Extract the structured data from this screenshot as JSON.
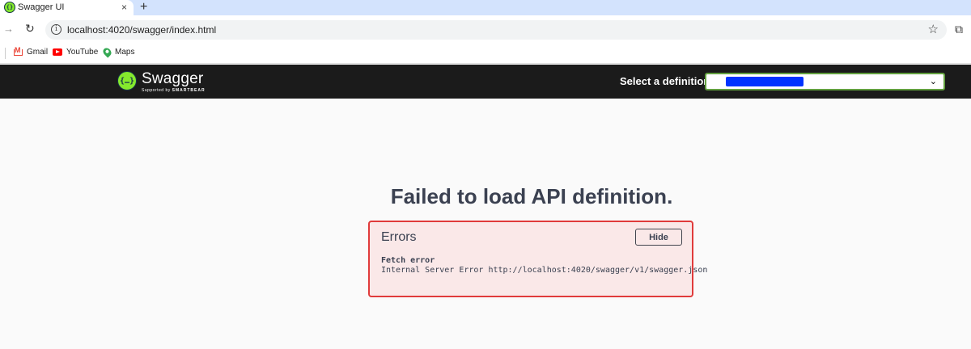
{
  "browser": {
    "tab_title": "Swagger UI",
    "tab_close": "×",
    "new_tab": "+",
    "url": "localhost:4020/swagger/index.html",
    "icons": {
      "favicon": "swagger-favicon",
      "forward": "forward-arrow-icon",
      "reload": "reload-icon",
      "info": "info-icon",
      "star": "star-icon",
      "extensions": "puzzle-icon"
    }
  },
  "bookmarks": [
    {
      "label": "Gmail",
      "icon": "gmail-icon"
    },
    {
      "label": "YouTube",
      "icon": "youtube-icon"
    },
    {
      "label": "Maps",
      "icon": "maps-icon"
    }
  ],
  "swagger": {
    "logo_text": "Swagger",
    "logo_sub_prefix": "Supported by",
    "logo_sub_brand": "SMARTBEAR",
    "definition_label": "Select a definition",
    "definition_value": "",
    "accent": "#85ea2d",
    "bar_color": "#1b1b1b"
  },
  "main": {
    "title": "Failed to load API definition.",
    "errors": {
      "heading": "Errors",
      "hide_label": "Hide",
      "items": [
        {
          "title": "Fetch error",
          "message": "Internal Server Error http://localhost:4020/swagger/v1/swagger.json"
        }
      ],
      "border_color": "#e03b3b",
      "background_color": "#fae8e8"
    }
  }
}
